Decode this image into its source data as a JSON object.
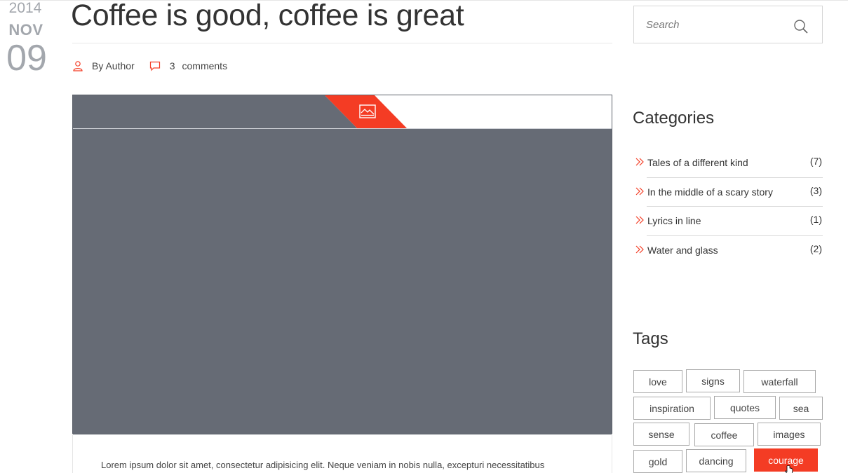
{
  "date": {
    "year": "2014",
    "month": "NOV",
    "day": "09"
  },
  "post": {
    "title": "Coffee is good, coffee is great",
    "author_label": "By Author",
    "comment_count": "3",
    "comment_label": "comments",
    "excerpt": "Lorem ipsum dolor sit amet, consectetur adipisicing elit. Neque veniam in nobis nulla, excepturi necessitatibus"
  },
  "search": {
    "placeholder": "Search"
  },
  "categories": {
    "title": "Categories",
    "items": [
      {
        "label": "Tales of a different kind",
        "count": "(7)"
      },
      {
        "label": "In the middle of a scary story",
        "count": "(3)"
      },
      {
        "label": "Lyrics in line",
        "count": "(1)"
      },
      {
        "label": "Water and glass",
        "count": "(2)"
      }
    ]
  },
  "tags": {
    "title": "Tags",
    "items": [
      "love",
      "signs",
      "waterfall",
      "inspiration",
      "quotes",
      "sea",
      "sense",
      "coffee",
      "images",
      "gold",
      "dancing",
      "courage"
    ],
    "active": "courage"
  },
  "colors": {
    "accent": "#f43c24",
    "media_bg": "#666b75",
    "muted": "#a3a7ad"
  },
  "icons": {
    "author": "user-icon",
    "comments": "comment-icon",
    "media": "image-icon",
    "search": "search-icon",
    "category": "double-chevron-right-icon"
  }
}
